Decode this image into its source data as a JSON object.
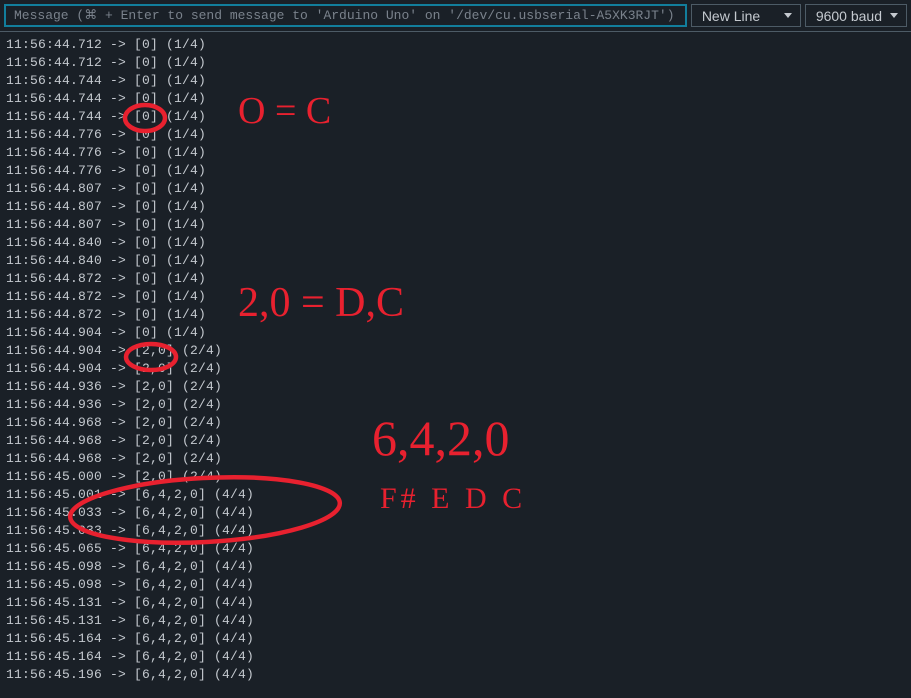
{
  "toolbar": {
    "input_placeholder": "Message (⌘ + Enter to send message to 'Arduino Uno' on '/dev/cu.usbserial-A5XK3RJT')",
    "input_value": "",
    "lineending_selected": "New Line",
    "baud_selected": "9600 baud"
  },
  "log_lines": [
    "11:56:44.712 -> [0] (1/4)",
    "11:56:44.712 -> [0] (1/4)",
    "11:56:44.744 -> [0] (1/4)",
    "11:56:44.744 -> [0] (1/4)",
    "11:56:44.744 -> [0] (1/4)",
    "11:56:44.776 -> [0] (1/4)",
    "11:56:44.776 -> [0] (1/4)",
    "11:56:44.776 -> [0] (1/4)",
    "11:56:44.807 -> [0] (1/4)",
    "11:56:44.807 -> [0] (1/4)",
    "11:56:44.807 -> [0] (1/4)",
    "11:56:44.840 -> [0] (1/4)",
    "11:56:44.840 -> [0] (1/4)",
    "11:56:44.872 -> [0] (1/4)",
    "11:56:44.872 -> [0] (1/4)",
    "11:56:44.872 -> [0] (1/4)",
    "11:56:44.904 -> [0] (1/4)",
    "11:56:44.904 -> [2,0] (2/4)",
    "11:56:44.904 -> [2,0] (2/4)",
    "11:56:44.936 -> [2,0] (2/4)",
    "11:56:44.936 -> [2,0] (2/4)",
    "11:56:44.968 -> [2,0] (2/4)",
    "11:56:44.968 -> [2,0] (2/4)",
    "11:56:44.968 -> [2,0] (2/4)",
    "11:56:45.000 -> [2,0] (2/4)",
    "11:56:45.001 -> [6,4,2,0] (4/4)",
    "11:56:45.033 -> [6,4,2,0] (4/4)",
    "11:56:45.033 -> [6,4,2,0] (4/4)",
    "11:56:45.065 -> [6,4,2,0] (4/4)",
    "11:56:45.098 -> [6,4,2,0] (4/4)",
    "11:56:45.098 -> [6,4,2,0] (4/4)",
    "11:56:45.131 -> [6,4,2,0] (4/4)",
    "11:56:45.131 -> [6,4,2,0] (4/4)",
    "11:56:45.164 -> [6,4,2,0] (4/4)",
    "11:56:45.164 -> [6,4,2,0] (4/4)",
    "11:56:45.196 -> [6,4,2,0] (4/4)"
  ],
  "annotations": {
    "note1": "O = C",
    "note2": "2,0 = D,C",
    "note3_main": "6,4,2,0",
    "note3_sub": "F#  E  D  C"
  }
}
